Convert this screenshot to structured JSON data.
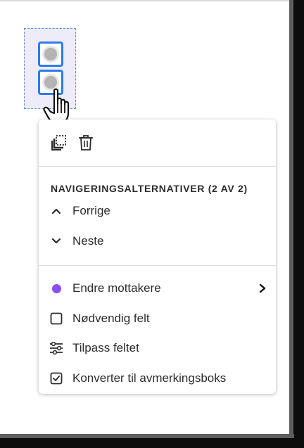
{
  "toolbar": {
    "duplicate_icon": "duplicate-icon",
    "delete_icon": "trash-icon"
  },
  "navigation": {
    "header": "NAVIGERINGSALTERNATIVER (2 AV 2)",
    "items": [
      {
        "label": "Forrige",
        "icon": "chevron-up-icon"
      },
      {
        "label": "Neste",
        "icon": "chevron-down-icon"
      }
    ]
  },
  "actions": {
    "items": [
      {
        "label": "Endre mottakere",
        "icon": "recipient-color-dot",
        "has_submenu": true
      },
      {
        "label": "Nødvendig felt",
        "icon": "checkbox-empty-icon"
      },
      {
        "label": "Tilpass feltet",
        "icon": "sliders-icon"
      },
      {
        "label": "Konverter til avmerkingsboks",
        "icon": "checkbox-checked-icon"
      }
    ]
  },
  "colors": {
    "selection_border": "#2f7bea",
    "selection_fill": "#efecf9",
    "recipient_dot": "#8a4ff5"
  }
}
